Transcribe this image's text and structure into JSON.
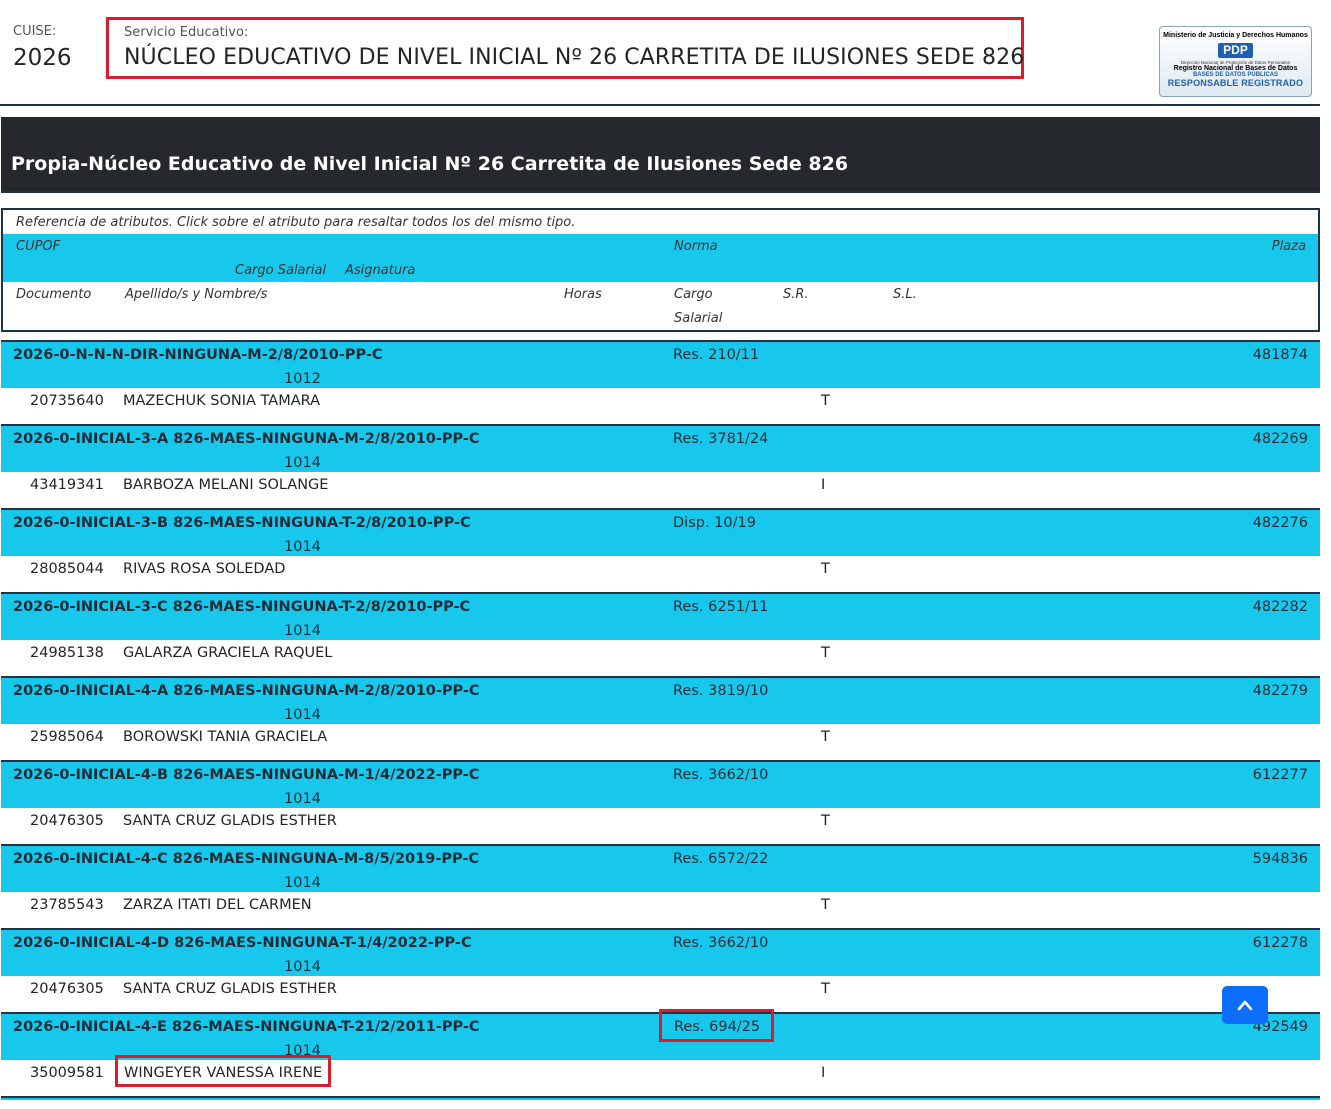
{
  "header": {
    "cuise_label": "CUISE:",
    "cuise_value": "2026",
    "servicio_label": "Servicio Educativo:",
    "servicio_name": "NÚCLEO EDUCATIVO DE NIVEL INICIAL Nº 26 CARRETITA DE ILUSIONES SEDE 826"
  },
  "badge": {
    "line1": "Ministerio de Justicia y Derechos Humanos",
    "logo": "PDP",
    "line2": "Dirección Nacional de Protección de Datos Personales",
    "line3": "Registro Nacional de Bases de Datos",
    "line4": "BASES DE DATOS PÚBLICAS",
    "line5": "RESPONSABLE REGISTRADO"
  },
  "banner": {
    "title": "Propia-Núcleo Educativo de Nivel Inicial Nº 26 Carretita de Ilusiones Sede 826"
  },
  "legend": {
    "note": "Referencia de atributos. Click sobre el atributo para resaltar todos los del mismo tipo.",
    "cupof": "CUPOF",
    "norma": "Norma",
    "plaza": "Plaza",
    "cargo_salarial": "Cargo Salarial",
    "asignatura": "Asignatura",
    "documento": "Documento",
    "apellido_nombre": "Apellido/s y Nombre/s",
    "horas": "Horas",
    "cargo": "Cargo",
    "salarial": "Salarial",
    "sr": "S.R.",
    "sl": "S.L."
  },
  "entries": [
    {
      "code": "2026-0-N-N-N-DIR-NINGUNA-M-2/8/2010-PP-C",
      "cargo": "1012",
      "norma": "Res. 210/11",
      "plaza": "481874",
      "documento": "20735640",
      "nombre": "MAZECHUK SONIA TAMARA",
      "sr": "T"
    },
    {
      "code": "2026-0-INICIAL-3-A 826-MAES-NINGUNA-M-2/8/2010-PP-C",
      "cargo": "1014",
      "norma": "Res. 3781/24",
      "plaza": "482269",
      "documento": "43419341",
      "nombre": "BARBOZA MELANI SOLANGE",
      "sr": "I"
    },
    {
      "code": "2026-0-INICIAL-3-B 826-MAES-NINGUNA-T-2/8/2010-PP-C",
      "cargo": "1014",
      "norma": "Disp. 10/19",
      "plaza": "482276",
      "documento": "28085044",
      "nombre": "RIVAS ROSA SOLEDAD",
      "sr": "T"
    },
    {
      "code": "2026-0-INICIAL-3-C 826-MAES-NINGUNA-T-2/8/2010-PP-C",
      "cargo": "1014",
      "norma": "Res. 6251/11",
      "plaza": "482282",
      "documento": "24985138",
      "nombre": "GALARZA GRACIELA RAQUEL",
      "sr": "T"
    },
    {
      "code": "2026-0-INICIAL-4-A 826-MAES-NINGUNA-M-2/8/2010-PP-C",
      "cargo": "1014",
      "norma": "Res. 3819/10",
      "plaza": "482279",
      "documento": "25985064",
      "nombre": "BOROWSKI TANIA GRACIELA",
      "sr": "T"
    },
    {
      "code": "2026-0-INICIAL-4-B 826-MAES-NINGUNA-M-1/4/2022-PP-C",
      "cargo": "1014",
      "norma": "Res. 3662/10",
      "plaza": "612277",
      "documento": "20476305",
      "nombre": "SANTA CRUZ GLADIS ESTHER",
      "sr": "T"
    },
    {
      "code": "2026-0-INICIAL-4-C 826-MAES-NINGUNA-M-8/5/2019-PP-C",
      "cargo": "1014",
      "norma": "Res. 6572/22",
      "plaza": "594836",
      "documento": "23785543",
      "nombre": "ZARZA ITATI DEL CARMEN",
      "sr": "T"
    },
    {
      "code": "2026-0-INICIAL-4-D 826-MAES-NINGUNA-T-1/4/2022-PP-C",
      "cargo": "1014",
      "norma": "Res. 3662/10",
      "plaza": "612278",
      "documento": "20476305",
      "nombre": "SANTA CRUZ GLADIS ESTHER",
      "sr": "T"
    },
    {
      "code": "2026-0-INICIAL-4-E 826-MAES-NINGUNA-T-21/2/2011-PP-C",
      "cargo": "1014",
      "norma": "Res. 694/25",
      "plaza": "492549",
      "documento": "35009581",
      "nombre": "WINGEYER VANESSA IRENE",
      "sr": "I"
    }
  ],
  "scroll_top": {
    "icon": "chevron-up-icon"
  }
}
